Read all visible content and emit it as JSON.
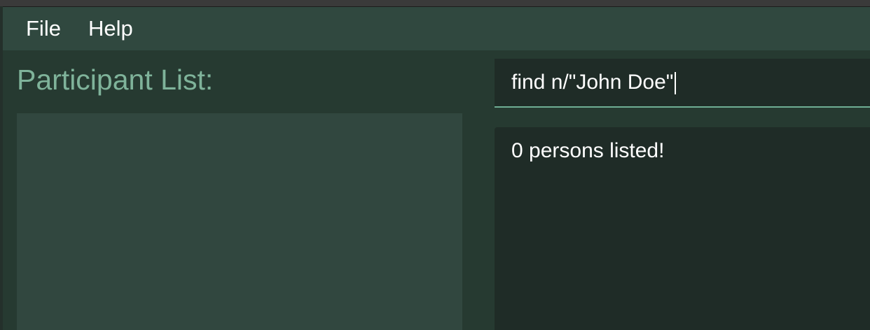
{
  "menubar": {
    "items": [
      {
        "label": "File"
      },
      {
        "label": "Help"
      }
    ]
  },
  "participant_list": {
    "title": "Participant List:"
  },
  "command": {
    "value": "find n/\"John Doe\""
  },
  "result": {
    "message": "0 persons listed!"
  },
  "colors": {
    "menubar_bg": "#30483f",
    "panel_bg": "#263a31",
    "list_panel_bg": "#31473f",
    "title_accent": "#7fb39a",
    "command_bg": "#1f2c27",
    "command_underline": "#6fae94",
    "text": "#ffffff"
  }
}
